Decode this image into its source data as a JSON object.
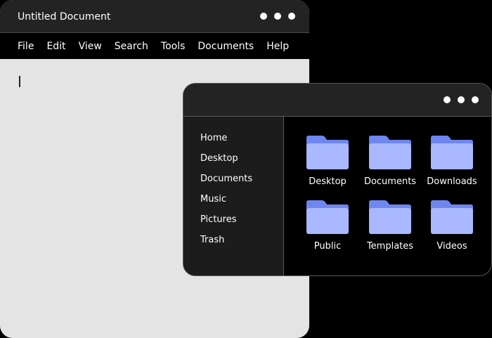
{
  "editor": {
    "title": "Untitled Document",
    "menu": [
      "File",
      "Edit",
      "View",
      "Search",
      "Tools",
      "Documents",
      "Help"
    ]
  },
  "file_manager": {
    "sidebar": [
      "Home",
      "Desktop",
      "Documents",
      "Music",
      "Pictures",
      "Trash"
    ],
    "folders": [
      "Desktop",
      "Documents",
      "Downloads",
      "Public",
      "Templates",
      "Videos"
    ]
  },
  "colors": {
    "background": "#000000",
    "titlebar": "#232323",
    "editor_canvas": "#e4e4e4",
    "sidebar": "#1c1c1c",
    "folder_back": "#6f86f0",
    "folder_front": "#a9b8ff"
  },
  "icons": {
    "window_control": "dot-icon",
    "folder": "folder-icon"
  }
}
